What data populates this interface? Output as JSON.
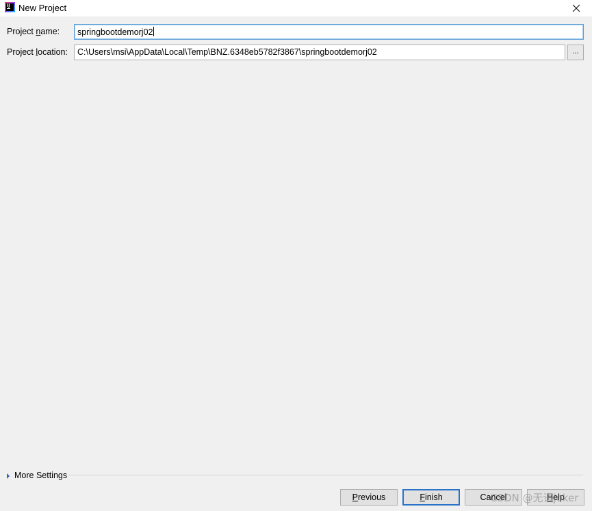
{
  "window": {
    "title": "New Project",
    "icon": "intellij-idea-icon",
    "close_icon": "close-icon"
  },
  "form": {
    "name_label": {
      "before": "Project ",
      "mnemonic": "n",
      "after": "ame:"
    },
    "name_value": "springbootdemorj02",
    "location_label": {
      "before": "Project ",
      "mnemonic": "l",
      "after": "ocation:"
    },
    "location_value": "C:\\Users\\msi\\AppData\\Local\\Temp\\BNZ.6348eb5782f3867\\springbootdemorj02",
    "browse_label": "..."
  },
  "more_settings": {
    "label": "More Settings",
    "expanded": false,
    "icon": "triangle-right-icon"
  },
  "buttons": {
    "previous": {
      "mnemonic": "P",
      "rest": "revious"
    },
    "finish": {
      "mnemonic": "F",
      "rest": "inish"
    },
    "cancel": "Cancel",
    "help": {
      "mnemonic": "H",
      "rest": "elp"
    }
  },
  "watermark": "CSDN @无语joker",
  "colors": {
    "background": "#f0f0f0",
    "focus_border": "#5a9ed6",
    "default_button_border": "#2a73c9",
    "expand_triangle": "#2f64b7"
  }
}
